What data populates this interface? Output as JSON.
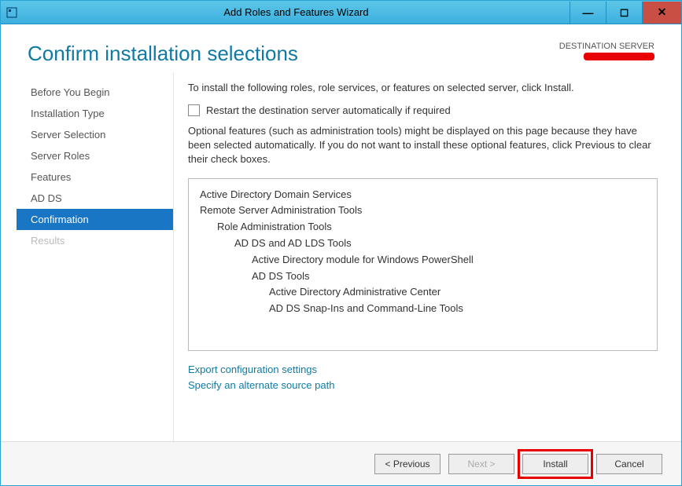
{
  "window": {
    "title": "Add Roles and Features Wizard"
  },
  "header": {
    "page_title": "Confirm installation selections",
    "destination_label": "DESTINATION SERVER"
  },
  "sidebar": {
    "steps": [
      {
        "label": "Before You Begin"
      },
      {
        "label": "Installation Type"
      },
      {
        "label": "Server Selection"
      },
      {
        "label": "Server Roles"
      },
      {
        "label": "Features"
      },
      {
        "label": "AD DS"
      },
      {
        "label": "Confirmation"
      },
      {
        "label": "Results"
      }
    ]
  },
  "main": {
    "intro_text": "To install the following roles, role services, or features on selected server, click Install.",
    "restart_checkbox_label": "Restart the destination server automatically if required",
    "optional_text": "Optional features (such as administration tools) might be displayed on this page because they have been selected automatically. If you do not want to install these optional features, click Previous to clear their check boxes.",
    "features": {
      "l0a": "Active Directory Domain Services",
      "l0b": "Remote Server Administration Tools",
      "l1a": "Role Administration Tools",
      "l2a": "AD DS and AD LDS Tools",
      "l3a": "Active Directory module for Windows PowerShell",
      "l3b": "AD DS Tools",
      "l4a": "Active Directory Administrative Center",
      "l4b": "AD DS Snap-Ins and Command-Line Tools"
    },
    "links": {
      "export": "Export configuration settings",
      "alt_source": "Specify an alternate source path"
    }
  },
  "footer": {
    "previous": "< Previous",
    "next": "Next >",
    "install": "Install",
    "cancel": "Cancel"
  }
}
